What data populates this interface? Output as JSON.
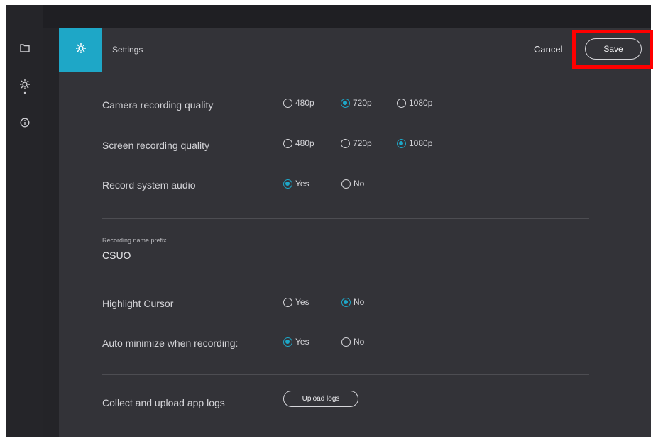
{
  "header": {
    "title": "Settings",
    "cancel_label": "Cancel",
    "save_label": "Save"
  },
  "sidebar": {
    "icons": [
      "folder-icon",
      "gear-icon",
      "info-icon"
    ]
  },
  "settings": {
    "camera_quality": {
      "label": "Camera recording quality",
      "options": [
        "480p",
        "720p",
        "1080p"
      ],
      "selected": "720p"
    },
    "screen_quality": {
      "label": "Screen recording quality",
      "options": [
        "480p",
        "720p",
        "1080p"
      ],
      "selected": "1080p"
    },
    "system_audio": {
      "label": "Record system audio",
      "options": [
        "Yes",
        "No"
      ],
      "selected": "Yes"
    },
    "name_prefix": {
      "label": "Recording name prefix",
      "value": "CSUO"
    },
    "highlight_cursor": {
      "label": "Highlight Cursor",
      "options": [
        "Yes",
        "No"
      ],
      "selected": "No"
    },
    "auto_minimize": {
      "label": "Auto minimize when recording:",
      "options": [
        "Yes",
        "No"
      ],
      "selected": "Yes"
    },
    "logs": {
      "label": "Collect and upload app logs",
      "button_label": "Upload logs"
    }
  },
  "colors": {
    "accent": "#1ea7c7",
    "highlight_box": "#ff0000",
    "panel_bg": "#333338",
    "app_bg": "#242428"
  }
}
